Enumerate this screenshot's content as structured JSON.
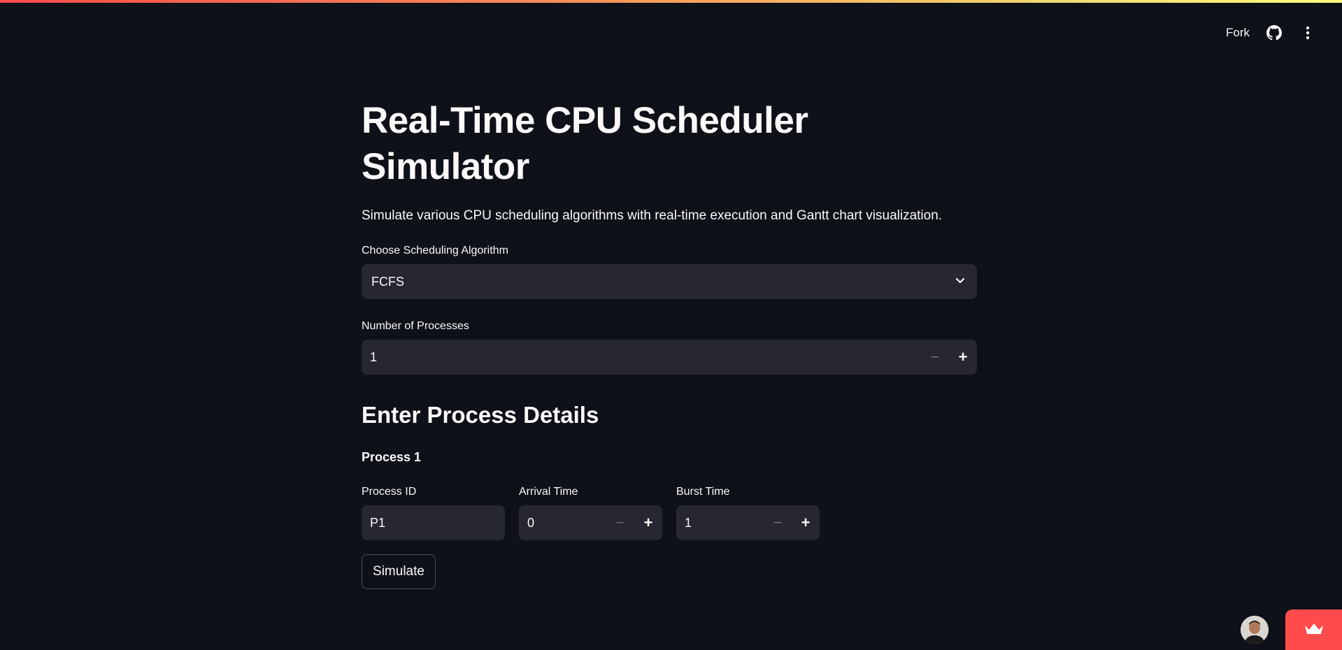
{
  "header": {
    "fork_label": "Fork",
    "github_icon": "github-icon",
    "menu_icon": "more-vertical-icon"
  },
  "main": {
    "title": "Real-Time CPU Scheduler Simulator",
    "subtitle": "Simulate various CPU scheduling algorithms with real-time execution and Gantt chart visualization.",
    "algorithm_select": {
      "label": "Choose Scheduling Algorithm",
      "selected": "FCFS"
    },
    "num_processes": {
      "label": "Number of Processes",
      "value": "1"
    },
    "section_title": "Enter Process Details",
    "process": {
      "heading": "Process 1",
      "process_id": {
        "label": "Process ID",
        "value": "P1"
      },
      "arrival_time": {
        "label": "Arrival Time",
        "value": "0"
      },
      "burst_time": {
        "label": "Burst Time",
        "value": "1"
      }
    },
    "simulate_label": "Simulate"
  },
  "stepper": {
    "minus": "−",
    "plus": "+"
  },
  "colors": {
    "background": "#0e1117",
    "input_bg": "#262730",
    "accent": "#ff4b4b"
  }
}
